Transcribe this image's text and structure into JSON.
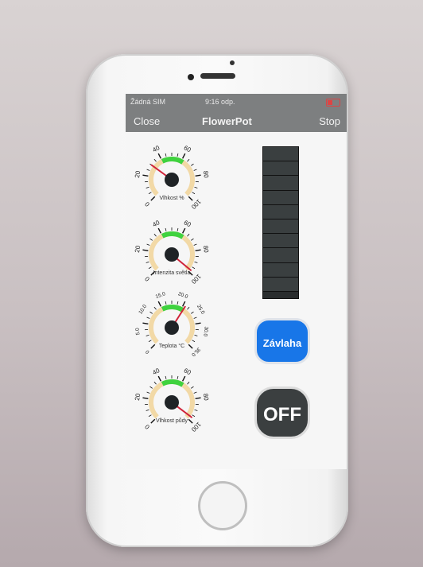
{
  "status_bar": {
    "carrier": "Žádná SIM",
    "time": "9:16 odp."
  },
  "nav": {
    "close": "Close",
    "title": "FlowerPot",
    "stop": "Stop"
  },
  "gauges": [
    {
      "label": "Vlhkost %",
      "ticks": [
        "0",
        "20",
        "40",
        "60",
        "80",
        "100"
      ],
      "value_fraction": 0.3
    },
    {
      "label": "Intenzita světla",
      "ticks": [
        "0",
        "20",
        "40",
        "60",
        "80",
        "100"
      ],
      "value_fraction": 0.98
    },
    {
      "label": "Teplota °C",
      "ticks": [
        "0",
        "5.0",
        "10.0",
        "15.0",
        "20.0",
        "25.0",
        "30.0",
        "35.0"
      ],
      "value_fraction": 0.62
    },
    {
      "label": "Vlhkost půdy",
      "ticks": [
        "0",
        "20",
        "40",
        "60",
        "80",
        "100"
      ],
      "value_fraction": 0.97
    }
  ],
  "level_bar": {
    "cells": 10,
    "filled": 0
  },
  "buttons": {
    "irrigation": "Závlaha",
    "off": "OFF"
  },
  "colors": {
    "nav_bar": "#7d7f80",
    "irrigation": "#1876e8",
    "off": "#3b3f40",
    "gauge_band": "#f2d9a6",
    "gauge_good": "#3fd23f",
    "needle": "#d0243a"
  }
}
